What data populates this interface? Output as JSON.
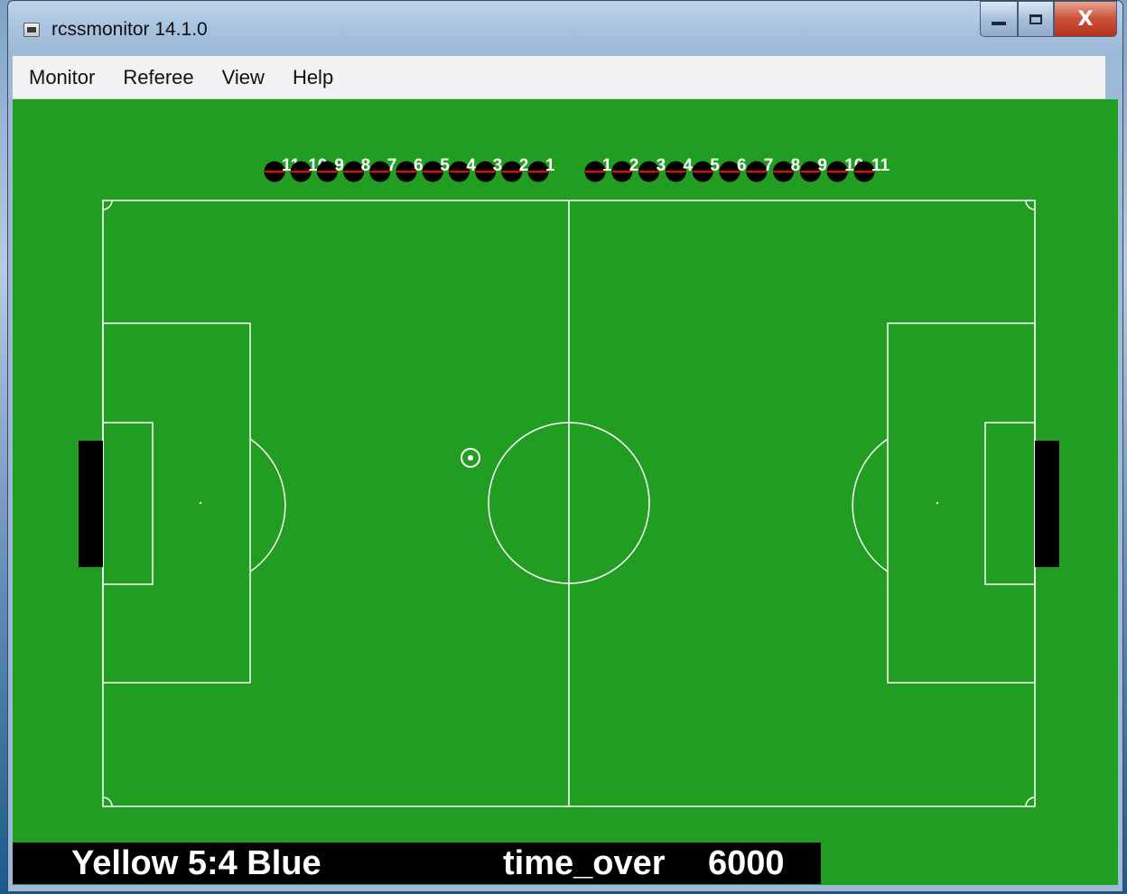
{
  "window": {
    "title": "rcssmonitor 14.1.0",
    "icon": "app-icon",
    "controls": {
      "minimize": "minimize-icon",
      "maximize": "maximize-icon",
      "close": "close-icon",
      "close_glyph": "X"
    }
  },
  "menu": {
    "items": [
      "Monitor",
      "Referee",
      "View",
      "Help"
    ]
  },
  "field": {
    "colors": {
      "grass": "#219e22",
      "lines": "#ffffff",
      "goal": "#000000",
      "player": "#000000",
      "player_number": "#ffffff",
      "heading": "#ff0000"
    }
  },
  "players": {
    "left_team": [
      "11",
      "10",
      "9",
      "8",
      "7",
      "6",
      "5",
      "4",
      "3",
      "2",
      "1"
    ],
    "right_team": [
      "1",
      "2",
      "3",
      "4",
      "5",
      "6",
      "7",
      "8",
      "9",
      "10",
      "11"
    ]
  },
  "scoreboard": {
    "score": "Yellow 5:4 Blue",
    "playmode": "time_over",
    "time": "6000"
  }
}
